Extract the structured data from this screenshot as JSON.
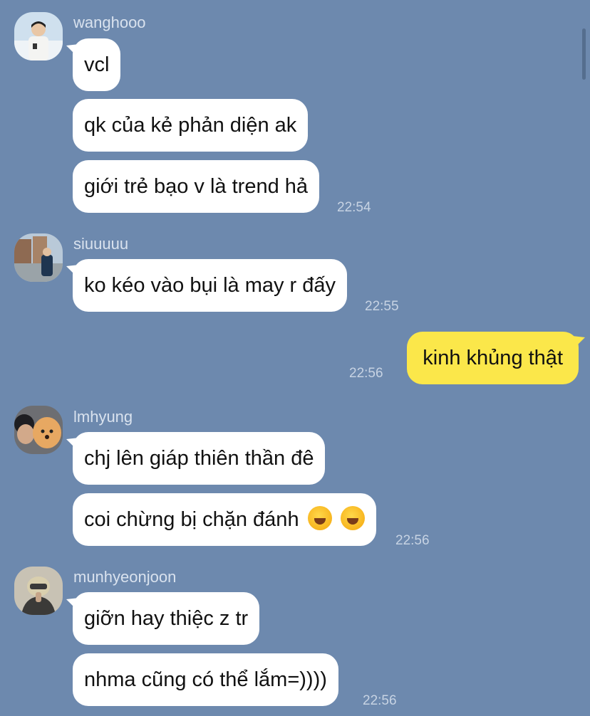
{
  "groups": [
    {
      "sender": "wanghooo",
      "messages": [
        "vcl",
        "qk của kẻ phản diện ak",
        "giới trẻ bạo v là trend hả"
      ],
      "time": "22:54"
    },
    {
      "sender": "siuuuuu",
      "messages": [
        "ko kéo vào bụi là may r đấy"
      ],
      "time": "22:55"
    },
    {
      "sender": "",
      "outgoing": true,
      "messages": [
        "kinh khủng thật"
      ],
      "time": "22:56"
    },
    {
      "sender": "lmhyung",
      "messages": [
        "chj lên giáp thiên thần đê",
        "coi chừng bị chặn đánh"
      ],
      "time": "22:56"
    },
    {
      "sender": "munhyeonjoon",
      "messages": [
        "giỡn hay thiệc z tr",
        "nhma cũng có thể lắm=))))"
      ],
      "time": "22:56"
    }
  ],
  "icons": {
    "emoji": "rolling-on-floor-laughing"
  },
  "colors": {
    "background": "#6d89ae",
    "incoming_bubble": "#ffffff",
    "outgoing_bubble": "#fbe74a"
  }
}
